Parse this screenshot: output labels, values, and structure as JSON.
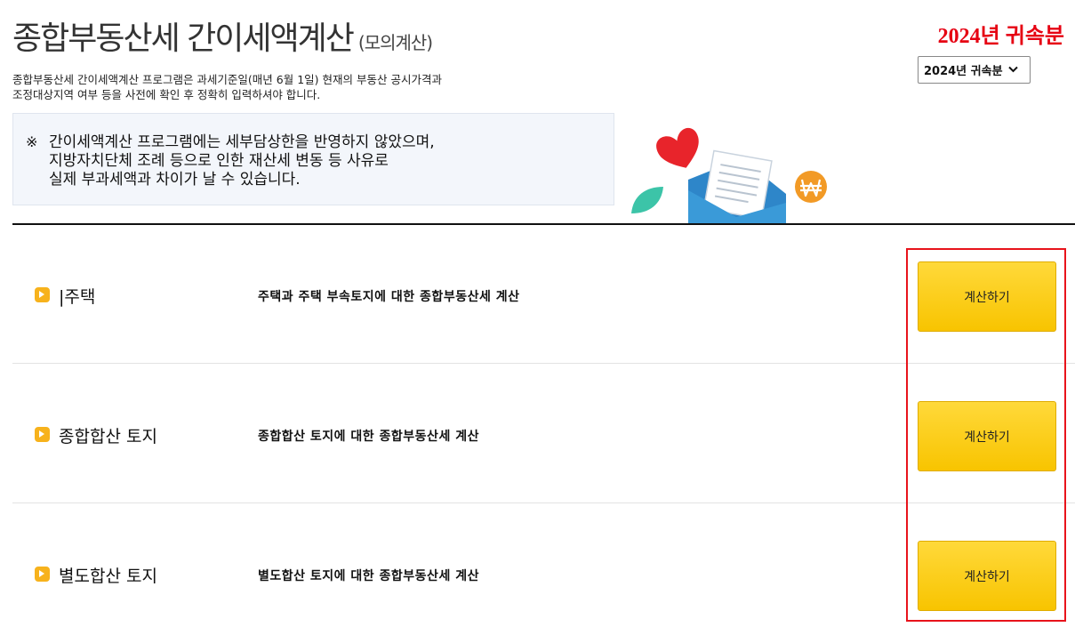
{
  "header": {
    "title": "종합부동산세 간이세액계산",
    "title_sub": "(모의계산)",
    "year_label": "2024년 귀속분",
    "year_select_value": "2024년 귀속분"
  },
  "description": [
    "종합부동산세 간이세액계산 프로그램은 과세기준일(매년 6월 1일) 현재의 부동산 공시가격과",
    "조정대상지역 여부 등을 사전에 확인 후 정확히 입력하셔야 합니다."
  ],
  "notice": {
    "mark": "※",
    "text": "간이세액계산 프로그램에는 세부담상한을 반영하지 않았으며,\n지방자치단체 조례 등으로 인한 재산세 변동 등 사유로\n실제 부과세액과 차이가 날 수 있습니다."
  },
  "rows": [
    {
      "label": "|주택",
      "description": "주택과 주택 부속토지에 대한 종합부동산세 계산",
      "button": "계산하기"
    },
    {
      "label": "종합합산 토지",
      "description": "종합합산 토지에 대한 종합부동산세 계산",
      "button": "계산하기"
    },
    {
      "label": "별도합산 토지",
      "description": "별도합산 토지에 대한 종합부동산세 계산",
      "button": "계산하기"
    }
  ],
  "icons": {
    "chevron": "chevron-down-icon",
    "bullet": "arrow-bullet-icon",
    "illustration": "envelope-heart-won-illustration"
  },
  "colors": {
    "accent_red": "#e60012",
    "button_yellow": "#ffd200",
    "bullet_orange": "#f7b21c",
    "highlight_red": "#e8131b",
    "notice_bg": "#f3f6fb"
  }
}
